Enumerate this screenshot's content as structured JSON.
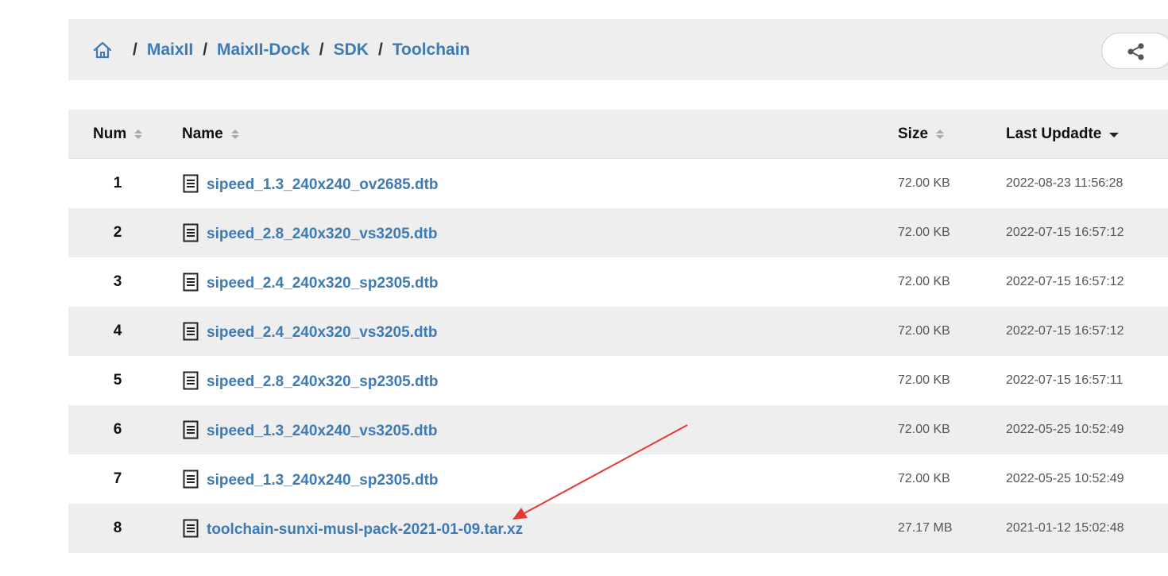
{
  "breadcrumb": {
    "home_icon": "home-icon",
    "separator": "/",
    "items": [
      {
        "label": "MaixII"
      },
      {
        "label": "MaixII-Dock"
      },
      {
        "label": "SDK"
      },
      {
        "label": "Toolchain"
      }
    ]
  },
  "share": {
    "icon": "share-icon"
  },
  "table": {
    "headers": {
      "num": "Num",
      "name": "Name",
      "size": "Size",
      "date": "Last Updadte"
    },
    "sorted_by": "date",
    "rows": [
      {
        "num": "1",
        "name": "sipeed_1.3_240x240_ov2685.dtb",
        "size": "72.00 KB",
        "date": "2022-08-23 11:56:28"
      },
      {
        "num": "2",
        "name": "sipeed_2.8_240x320_vs3205.dtb",
        "size": "72.00 KB",
        "date": "2022-07-15 16:57:12"
      },
      {
        "num": "3",
        "name": "sipeed_2.4_240x320_sp2305.dtb",
        "size": "72.00 KB",
        "date": "2022-07-15 16:57:12"
      },
      {
        "num": "4",
        "name": "sipeed_2.4_240x320_vs3205.dtb",
        "size": "72.00 KB",
        "date": "2022-07-15 16:57:12"
      },
      {
        "num": "5",
        "name": "sipeed_2.8_240x320_sp2305.dtb",
        "size": "72.00 KB",
        "date": "2022-07-15 16:57:11"
      },
      {
        "num": "6",
        "name": "sipeed_1.3_240x240_vs3205.dtb",
        "size": "72.00 KB",
        "date": "2022-05-25 10:52:49"
      },
      {
        "num": "7",
        "name": "sipeed_1.3_240x240_sp2305.dtb",
        "size": "72.00 KB",
        "date": "2022-05-25 10:52:49"
      },
      {
        "num": "8",
        "name": "toolchain-sunxi-musl-pack-2021-01-09.tar.xz",
        "size": "27.17 MB",
        "date": "2021-01-12 15:02:48"
      }
    ]
  },
  "annotation": {
    "color": "#e53935"
  },
  "colors": {
    "link": "#3e7ab3",
    "band": "#eeeeee"
  }
}
